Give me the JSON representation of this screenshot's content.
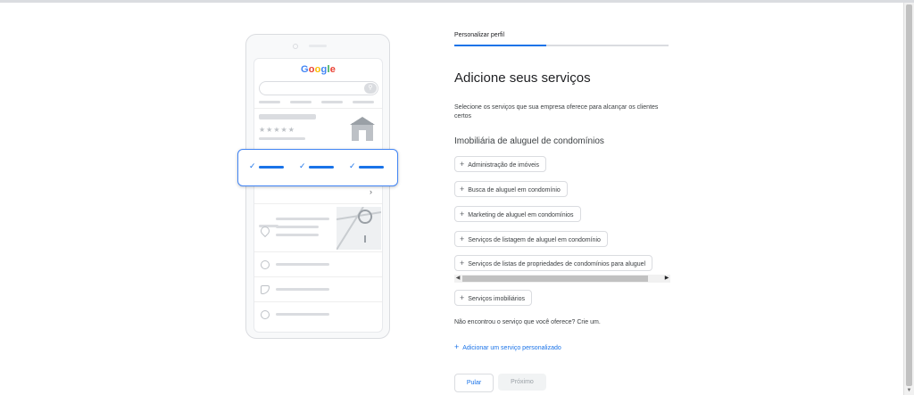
{
  "illustration": {
    "logo": {
      "letters": [
        "G",
        "o",
        "o",
        "g",
        "l",
        "e"
      ]
    },
    "stars": "★★★★★",
    "icons": [
      "store-icon",
      "chevron-right-icon",
      "location-pin-icon",
      "clock-icon",
      "phone-icon",
      "globe-icon",
      "check-icon"
    ]
  },
  "header": {
    "step_label": "Personalizar perfil",
    "progress": 0.43
  },
  "main": {
    "title": "Adicione seus serviços",
    "description": "Selecione os serviços que sua empresa oferece para alcançar os clientes certos",
    "category": "Imobiliária de aluguel de condomínios",
    "services": [
      "Administração de imóveis",
      "Busca de aluguel em condomínio",
      "Marketing de aluguel em condomínios",
      "Serviços de listagem de aluguel em condomínio",
      "Serviços de listas de propriedades de condomínios para aluguel",
      "Serviços imobiliários"
    ],
    "not_found_note": "Não encontrou o serviço que você oferece? Crie um.",
    "add_custom": "Adicionar um serviço personalizado"
  },
  "footer": {
    "skip_label": "Pular",
    "next_label": "Próximo"
  },
  "colors": {
    "accent": "#1a73e8",
    "border": "#dadce0",
    "text": "#202124"
  }
}
